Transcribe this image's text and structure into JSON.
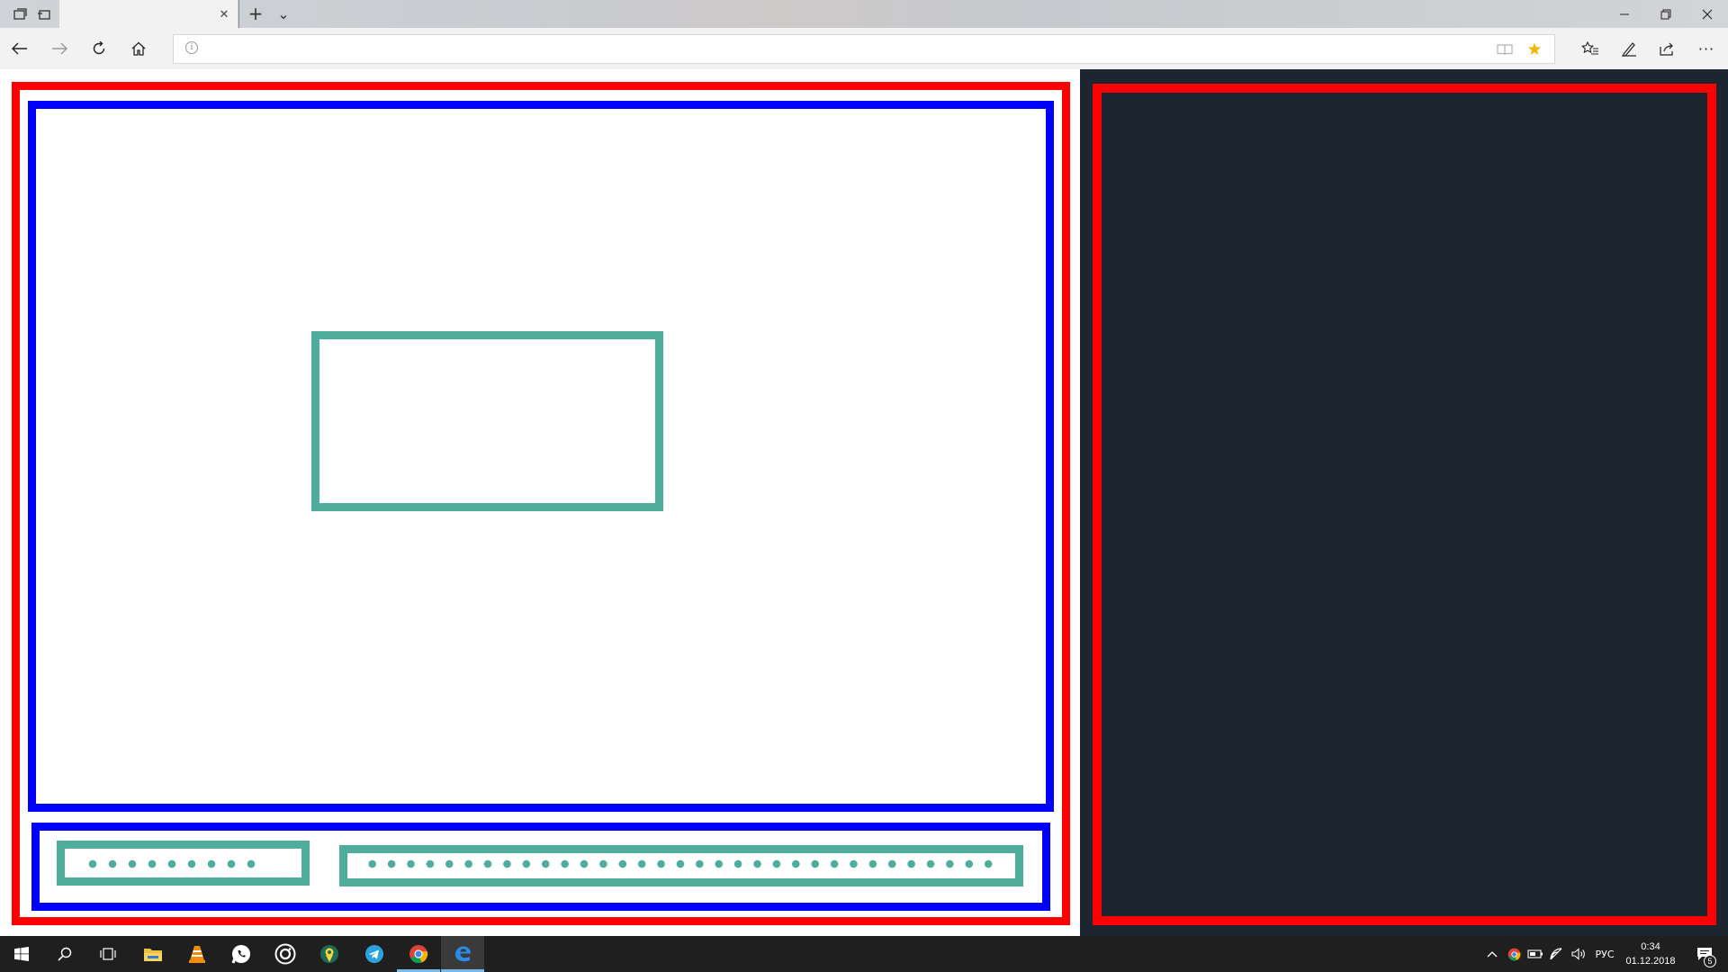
{
  "colors": {
    "red_frame": "#ff0000",
    "blue_frame": "#0000ff",
    "teal_frame": "#4fad9b",
    "dark_panel": "#1d2530",
    "taskbar": "#1f1f1f",
    "active_tab": "#f2f2f2",
    "favorite_star": "#f2b600"
  },
  "browser": {
    "tab_close_glyph": "✕",
    "new_tab_glyph": "+",
    "tab_list_glyph": "⌄",
    "minimize_glyph": "—",
    "restore_glyph": "❐",
    "close_glyph": "✕",
    "back_glyph": "←",
    "forward_glyph": "→",
    "refresh_glyph": "↻",
    "home_glyph": "⌂",
    "address_value": "",
    "info_glyph": "i",
    "reading_view_glyph": "📖",
    "favorite_glyph": "★",
    "favorites_hub_glyph": "☆",
    "notes_glyph": "✎",
    "share_glyph": "⇪",
    "more_glyph": "···"
  },
  "taskbar": {
    "apps": [
      "start-icon",
      "search-icon",
      "task-view-icon",
      "file-explorer-icon",
      "vlc-icon",
      "whatsapp-icon",
      "camera-app-icon",
      "maps-app-icon",
      "telegram-icon",
      "chrome-icon",
      "edge-icon"
    ],
    "language": "РУС",
    "time": "0:34",
    "date": "01.12.2018",
    "notifications_count": "5"
  }
}
